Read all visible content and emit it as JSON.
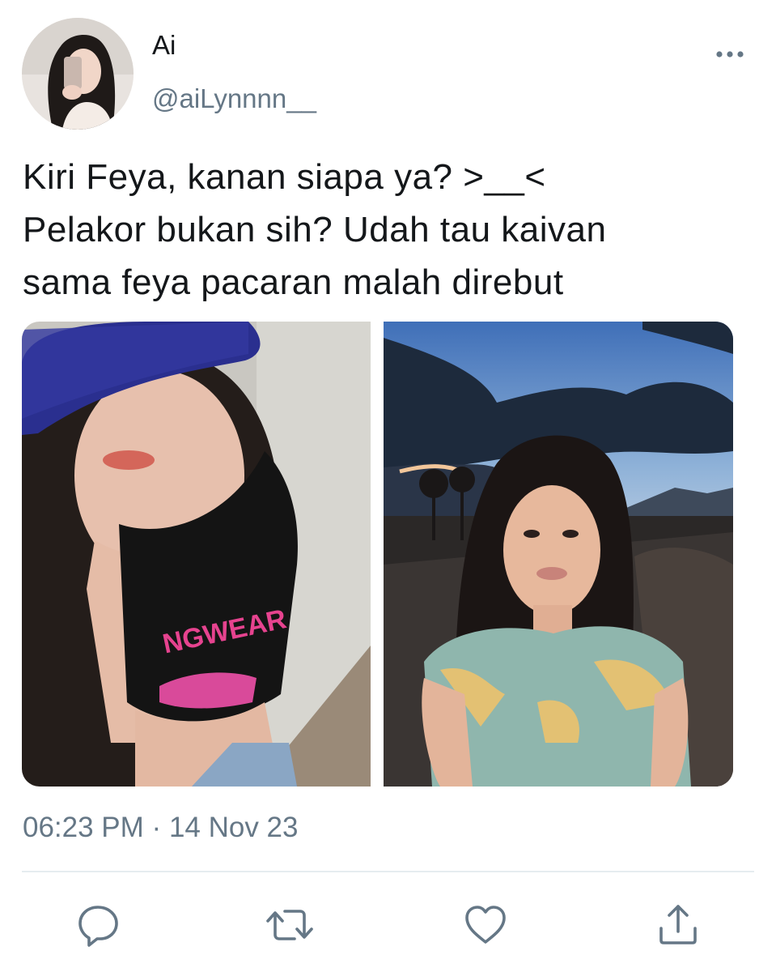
{
  "tweet": {
    "author": {
      "display_name": "Ai",
      "handle": "@aiLynnnn__",
      "avatar_icon": "avatar-photo"
    },
    "text_lines": [
      "Kiri Feya, kanan siapa ya? >__<",
      "Pelakor bukan sih? Udah tau kaivan",
      "sama feya pacaran malah direbut"
    ],
    "media": [
      {
        "icon": "photo",
        "shirt_text": "NGWEAR"
      },
      {
        "icon": "photo"
      }
    ],
    "time": "06:23 PM",
    "separator": "·",
    "date": "14 Nov 23"
  },
  "actions": {
    "reply_icon": "reply-icon",
    "retweet_icon": "retweet-icon",
    "like_icon": "heart-icon",
    "share_icon": "share-icon",
    "more_icon": "more-icon"
  },
  "colors": {
    "text": "#14171a",
    "secondary": "#657786",
    "divider": "#e6ecf0"
  }
}
